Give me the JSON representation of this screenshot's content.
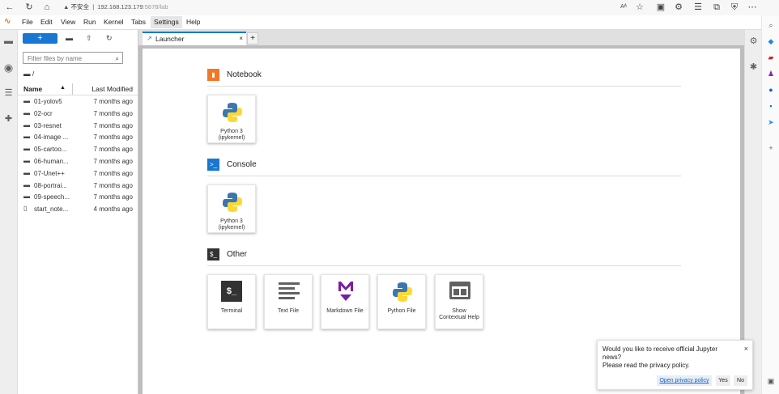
{
  "browser": {
    "security_label": "不安全",
    "url_host": "192.168.123.179",
    "url_path": ":5678/lab",
    "reader_label": "Aᴬ"
  },
  "menubar": {
    "items": [
      "File",
      "Edit",
      "View",
      "Run",
      "Kernel",
      "Tabs",
      "Settings",
      "Help"
    ]
  },
  "filebrowser": {
    "new_label": "+",
    "filter_placeholder": "Filter files by name",
    "breadcrumb": "/",
    "col_name": "Name",
    "col_modified": "Last Modified",
    "files": [
      {
        "name": "01-yolov5",
        "modified": "7 months ago",
        "icon": "folder-icon"
      },
      {
        "name": "02-ocr",
        "modified": "7 months ago",
        "icon": "folder-icon"
      },
      {
        "name": "03-resnet",
        "modified": "7 months ago",
        "icon": "folder-icon"
      },
      {
        "name": "04-image ...",
        "modified": "7 months ago",
        "icon": "folder-icon"
      },
      {
        "name": "05-cartoo...",
        "modified": "7 months ago",
        "icon": "folder-icon"
      },
      {
        "name": "06-human...",
        "modified": "7 months ago",
        "icon": "folder-icon"
      },
      {
        "name": "07-Unet++",
        "modified": "7 months ago",
        "icon": "folder-icon"
      },
      {
        "name": "08-portrai...",
        "modified": "7 months ago",
        "icon": "folder-icon"
      },
      {
        "name": "09-speech...",
        "modified": "7 months ago",
        "icon": "folder-icon"
      },
      {
        "name": "start_note...",
        "modified": "4 months ago",
        "icon": "file-icon"
      }
    ]
  },
  "tab": {
    "label": "Launcher",
    "close": "×",
    "add": "+"
  },
  "launcher": {
    "sections": [
      {
        "title": "Notebook",
        "icon_glyph": "■",
        "color": "#f37726"
      },
      {
        "title": "Console",
        "icon_glyph": ">_",
        "color": "#1976d2"
      },
      {
        "title": "Other",
        "icon_glyph": "$_",
        "color": "#333333"
      }
    ],
    "notebook_card": {
      "line1": "Python 3",
      "line2": "(ipykernel)"
    },
    "console_card": {
      "line1": "Python 3",
      "line2": "(ipykernel)"
    },
    "other_cards": [
      {
        "label": "Terminal",
        "icon": "terminal-icon"
      },
      {
        "label": "Text File",
        "icon": "text-file-icon"
      },
      {
        "label": "Markdown File",
        "icon": "markdown-icon"
      },
      {
        "label": "Python File",
        "icon": "python-icon"
      },
      {
        "label": "Show Contextual Help",
        "icon": "contextual-help-icon"
      }
    ]
  },
  "notification": {
    "message_line1": "Would you like to receive official Jupyter",
    "message_line2": "news?",
    "message_line3": "Please read the privacy policy.",
    "privacy_button": "Open privacy policy",
    "yes_button": "Yes",
    "no_button": "No",
    "close": "×"
  },
  "colors": {
    "accent": "#1976d2",
    "notebook_orange": "#f37726",
    "markdown_purple": "#7b1fa2"
  }
}
